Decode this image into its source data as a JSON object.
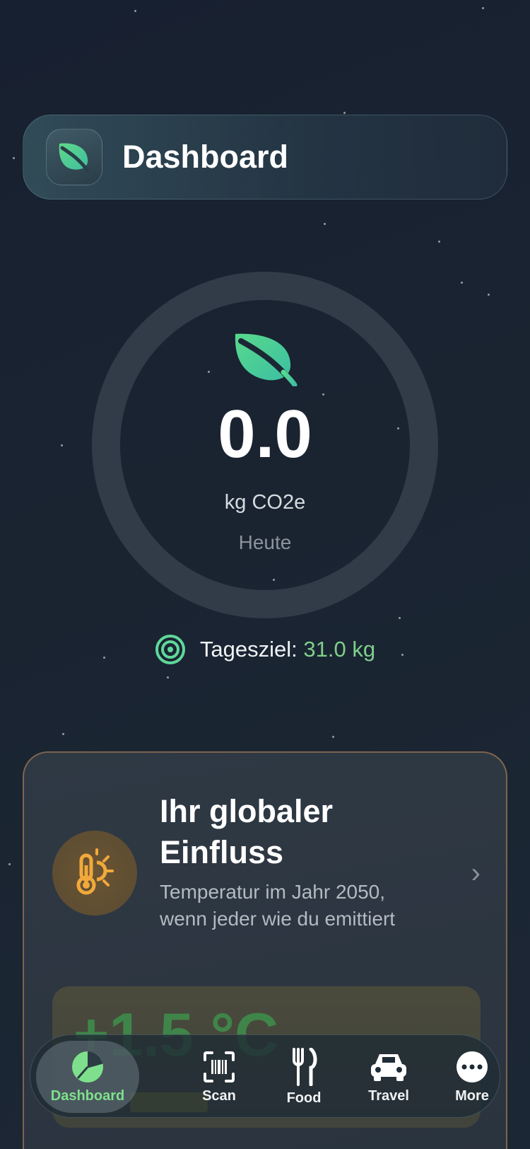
{
  "header": {
    "title": "Dashboard",
    "icon": "leaf-icon"
  },
  "ring": {
    "value": "0.0",
    "unit": "kg CO2e",
    "label": "Heute",
    "progress": 0.0
  },
  "goal": {
    "label": "Tagesziel:",
    "value": "31.0 kg",
    "icon": "target-icon"
  },
  "impact_card": {
    "title": "Ihr globaler Einfluss",
    "description": "Temperatur im Jahr 2050, wenn jeder wie du emittiert",
    "temperature": "+1.5 °C",
    "icon": "thermometer-sun-icon"
  },
  "tabs": [
    {
      "label": "Dashboard",
      "icon": "pie-chart-icon",
      "active": true
    },
    {
      "label": "Scan",
      "icon": "barcode-scan-icon",
      "active": false
    },
    {
      "label": "Food",
      "icon": "fork-knife-icon",
      "active": false
    },
    {
      "label": "Travel",
      "icon": "car-icon",
      "active": false
    },
    {
      "label": "More",
      "icon": "more-icon",
      "active": false
    }
  ],
  "colors": {
    "accent": "#7ee08c",
    "background": "#1a2431",
    "ring": "#313c48",
    "warning": "#f2a93b"
  }
}
